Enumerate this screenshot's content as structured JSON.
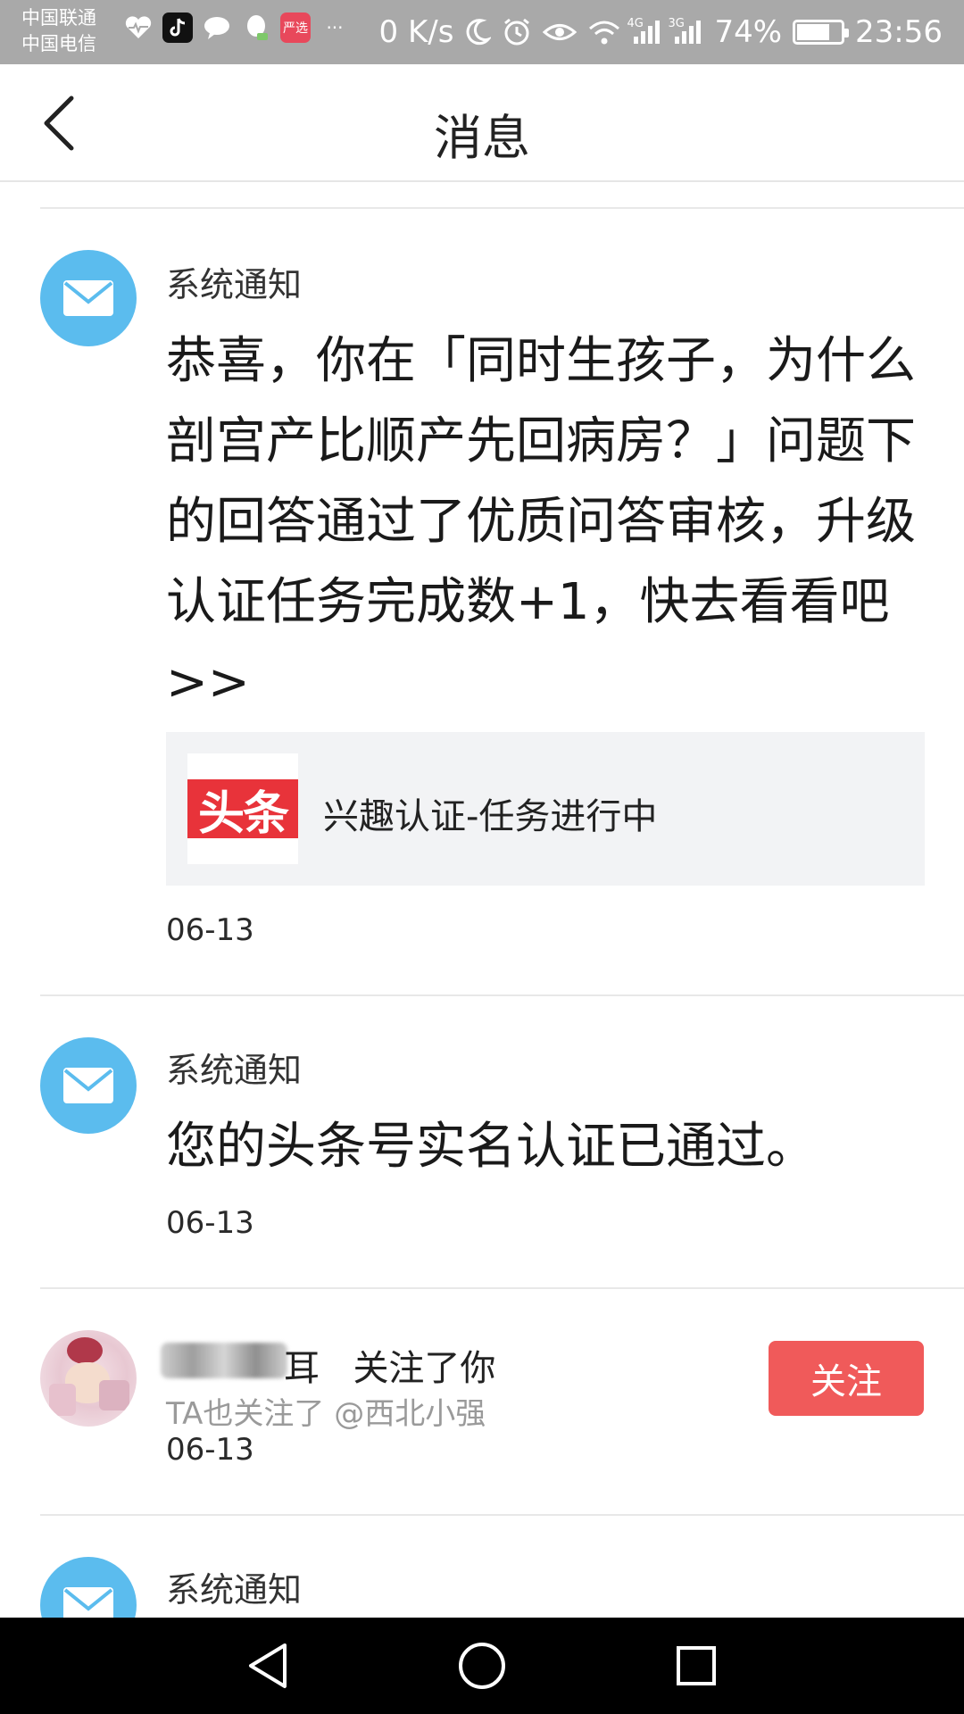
{
  "status_bar": {
    "carrier_1": "中国联通",
    "carrier_2": "中国电信",
    "net_speed": "0 K/s",
    "signal_1": "4G",
    "signal_2": "3G",
    "battery_percent": "74%",
    "battery_level": 0.74,
    "time": "23:56",
    "app_icons": [
      "heart-pulse-icon",
      "tiktok-icon",
      "chat-icon",
      "qq-icon",
      "yanxuan-icon",
      "more-icon"
    ],
    "yanxuan_label": "严选",
    "more_label": "···"
  },
  "header": {
    "title": "消息"
  },
  "messages": [
    {
      "type": "system",
      "sender": "系统通知",
      "body": "恭喜，你在「同时生孩子，为什么剖宫产比顺产先回病房？」问题下的回答通过了优质问答审核，升级认证任务完成数+1，快去看看吧>>",
      "card": {
        "logo_text": "头条",
        "text": "兴趣认证-任务进行中"
      },
      "date": "06-13"
    },
    {
      "type": "system",
      "sender": "系统通知",
      "body": "您的头条号实名认证已通过。",
      "date": "06-13"
    },
    {
      "type": "follow",
      "name_suffix": "耳",
      "action": "关注了你",
      "sub": "TA也关注了 @西北小强",
      "date": "06-13",
      "button_label": "关注"
    },
    {
      "type": "system",
      "sender": "系统通知"
    }
  ],
  "colors": {
    "status_bar_bg": "#a9a9a9",
    "mail_avatar": "#5bbcee",
    "follow_button": "#f05a5a",
    "card_bg": "#f2f3f5",
    "toutiao_red": "#e8333a"
  }
}
